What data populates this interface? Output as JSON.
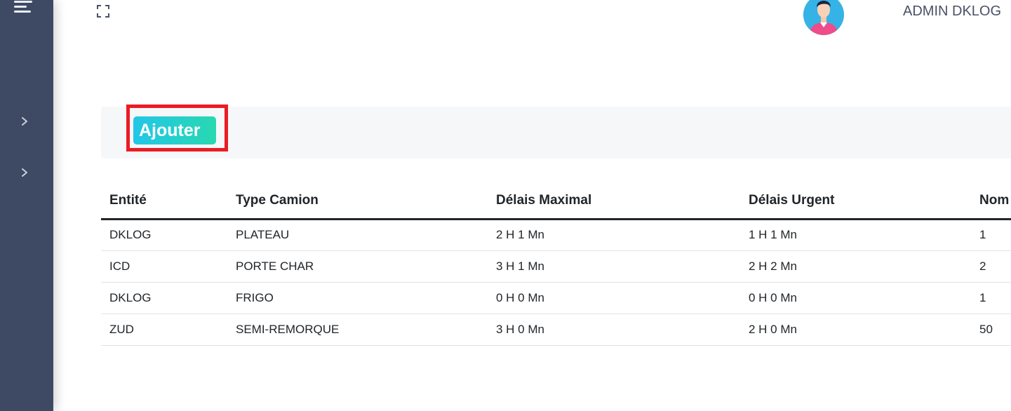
{
  "header": {
    "username": "ADMIN DKLOG",
    "icons": {
      "menu": "hamburger-menu-icon",
      "fullscreen": "fullscreen-icon",
      "avatar": "user-avatar"
    }
  },
  "sidebar": {
    "items": [
      {
        "icon": "chevron-right-icon"
      },
      {
        "icon": "chevron-right-icon"
      }
    ]
  },
  "actions": {
    "add_label": "Ajouter"
  },
  "table": {
    "columns": [
      "Entité",
      "Type Camion",
      "Délais Maximal",
      "Délais Urgent",
      "Nom"
    ],
    "rows": [
      [
        "DKLOG",
        "PLATEAU",
        "2 H 1 Mn",
        "1 H 1 Mn",
        "1"
      ],
      [
        "ICD",
        "PORTE CHAR",
        "3 H 1 Mn",
        "2 H 2 Mn",
        "2"
      ],
      [
        "DKLOG",
        "FRIGO",
        "0 H 0 Mn",
        "0 H 0 Mn",
        "1"
      ],
      [
        "ZUD",
        "SEMI-REMORQUE",
        "3 H 0 Mn",
        "2 H 0 Mn",
        "50"
      ]
    ]
  },
  "colors": {
    "sidebar": "#3e4a64",
    "highlight": "#ea1c24",
    "button_gradient_start": "#22c6e8",
    "button_gradient_end": "#28d8b0"
  }
}
